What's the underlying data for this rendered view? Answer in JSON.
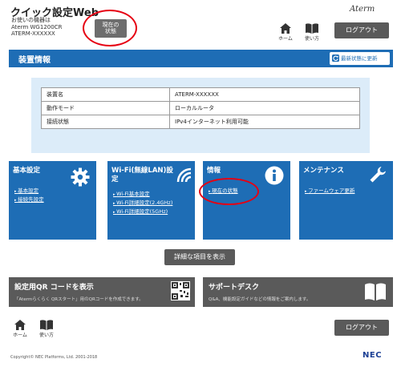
{
  "header": {
    "title": "クイック設定Web",
    "device_line1": "お使いの機器は",
    "device_line2": "Aterm WG1200CR",
    "device_line3": "ATERM-XXXXXX",
    "status_button_line1": "現在の",
    "status_button_line2": "状態",
    "logo": "Aterm",
    "home_label": "ホーム",
    "help_label": "使い方",
    "logout_label": "ログアウト"
  },
  "device_info": {
    "title": "装置情報",
    "refresh_label": "最新状態に更新",
    "rows": [
      {
        "key": "装置名",
        "value": "ATERM-XXXXXX"
      },
      {
        "key": "動作モード",
        "value": "ローカルルータ"
      },
      {
        "key": "接続状態",
        "value": "IPv4インターネット利用可能"
      }
    ]
  },
  "cards": {
    "basic": {
      "title": "基本設定",
      "links": [
        "基本設定",
        "接続先設定"
      ]
    },
    "wifi": {
      "title_line1": "Wi-Fi(無線LAN)設",
      "title_line2": "定",
      "links": [
        "Wi-Fi基本設定",
        "Wi-Fi詳細設定(2.4GHz)",
        "Wi-Fi詳細設定(5GHz)"
      ]
    },
    "info": {
      "title": "情報",
      "links": [
        "現在の状態"
      ]
    },
    "maintenance": {
      "title": "メンテナンス",
      "links": [
        "ファームウェア更新"
      ]
    }
  },
  "detail_button": "詳細な項目を表示",
  "qr_card": {
    "title": "設定用QR コードを表示",
    "desc": "「Atermらくらく QRスタート」用のQRコードを作成できます。"
  },
  "support_card": {
    "title": "サポートデスク",
    "desc": "Q&A、機能設定ガイドなどの情報をご案内します。"
  },
  "footer": {
    "home_label": "ホーム",
    "help_label": "使い方",
    "logout_label": "ログアウト",
    "copyright": "Copyright© NEC Platforms, Ltd. 2001-2018",
    "logo": "NEC"
  },
  "colors": {
    "accent": "#1e6db5",
    "panel": "#dcecf9",
    "button": "#5a5a5a",
    "highlight": "#e60012"
  }
}
